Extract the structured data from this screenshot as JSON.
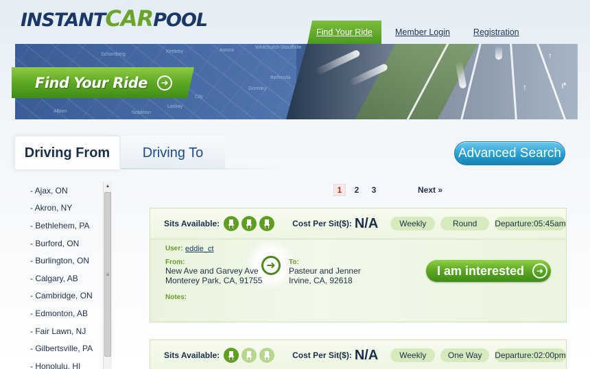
{
  "brand": {
    "logo_instant": "INSTANT",
    "logo_car": "CAR",
    "logo_pool": "POOL"
  },
  "nav": [
    {
      "label": "Find Your Ride",
      "active": true
    },
    {
      "label": "Member Login",
      "active": false
    },
    {
      "label": "Registration",
      "active": false
    }
  ],
  "banner": {
    "title": "Find Your Ride",
    "map_labels": [
      "Schomberg",
      "Kettleby",
      "Aurora",
      "Whitchurch-Stouffville",
      "Bethesda",
      "Gormley",
      "City",
      "Laskay",
      "Nobleton",
      "Albion"
    ]
  },
  "tabs": {
    "driving_from": "Driving From",
    "driving_to": "Driving To"
  },
  "advanced_search": "Advanced Search",
  "cities": [
    "- Ajax, ON",
    "- Akron, NY",
    "- Bethlehem, PA",
    "- Burford, ON",
    "- Burlington, ON",
    "- Calgary, AB",
    "- Cambridge, ON",
    "- Edmonton, AB",
    "- Fair Lawn, NJ",
    "- Gilbertsville, PA",
    "- Honolulu, HI"
  ],
  "pagination": {
    "pages": [
      "1",
      "2",
      "3"
    ],
    "current": "1",
    "next": "Next »"
  },
  "labels": {
    "sits_available": "Sits Available:",
    "cost_per_sit": "Cost Per Sit($):",
    "user": "User:",
    "from": "From:",
    "to": "To:",
    "notes": "Notes:",
    "interested": "I am interested"
  },
  "rides": [
    {
      "seats_total": 3,
      "seats_available": 3,
      "cost": "N/A",
      "frequency": "Weekly",
      "trip": "Round",
      "departure": "Departure:05:45am",
      "user": "eddie_ct",
      "from_line1": "New Ave and Garvey Ave",
      "from_line2": "Monterey Park, CA, 91755",
      "to_line1": "Pasteur and Jenner",
      "to_line2": "Irvine, CA, 92618"
    },
    {
      "seats_total": 3,
      "seats_available": 1,
      "cost": "N/A",
      "frequency": "Weekly",
      "trip": "One Way",
      "departure": "Departure:02:00pm"
    }
  ],
  "colors": {
    "brand_navy": "#1a3766",
    "brand_green": "#6aa52a",
    "accent_blue": "#279ed0",
    "current_page_red": "#cc1f1f"
  }
}
